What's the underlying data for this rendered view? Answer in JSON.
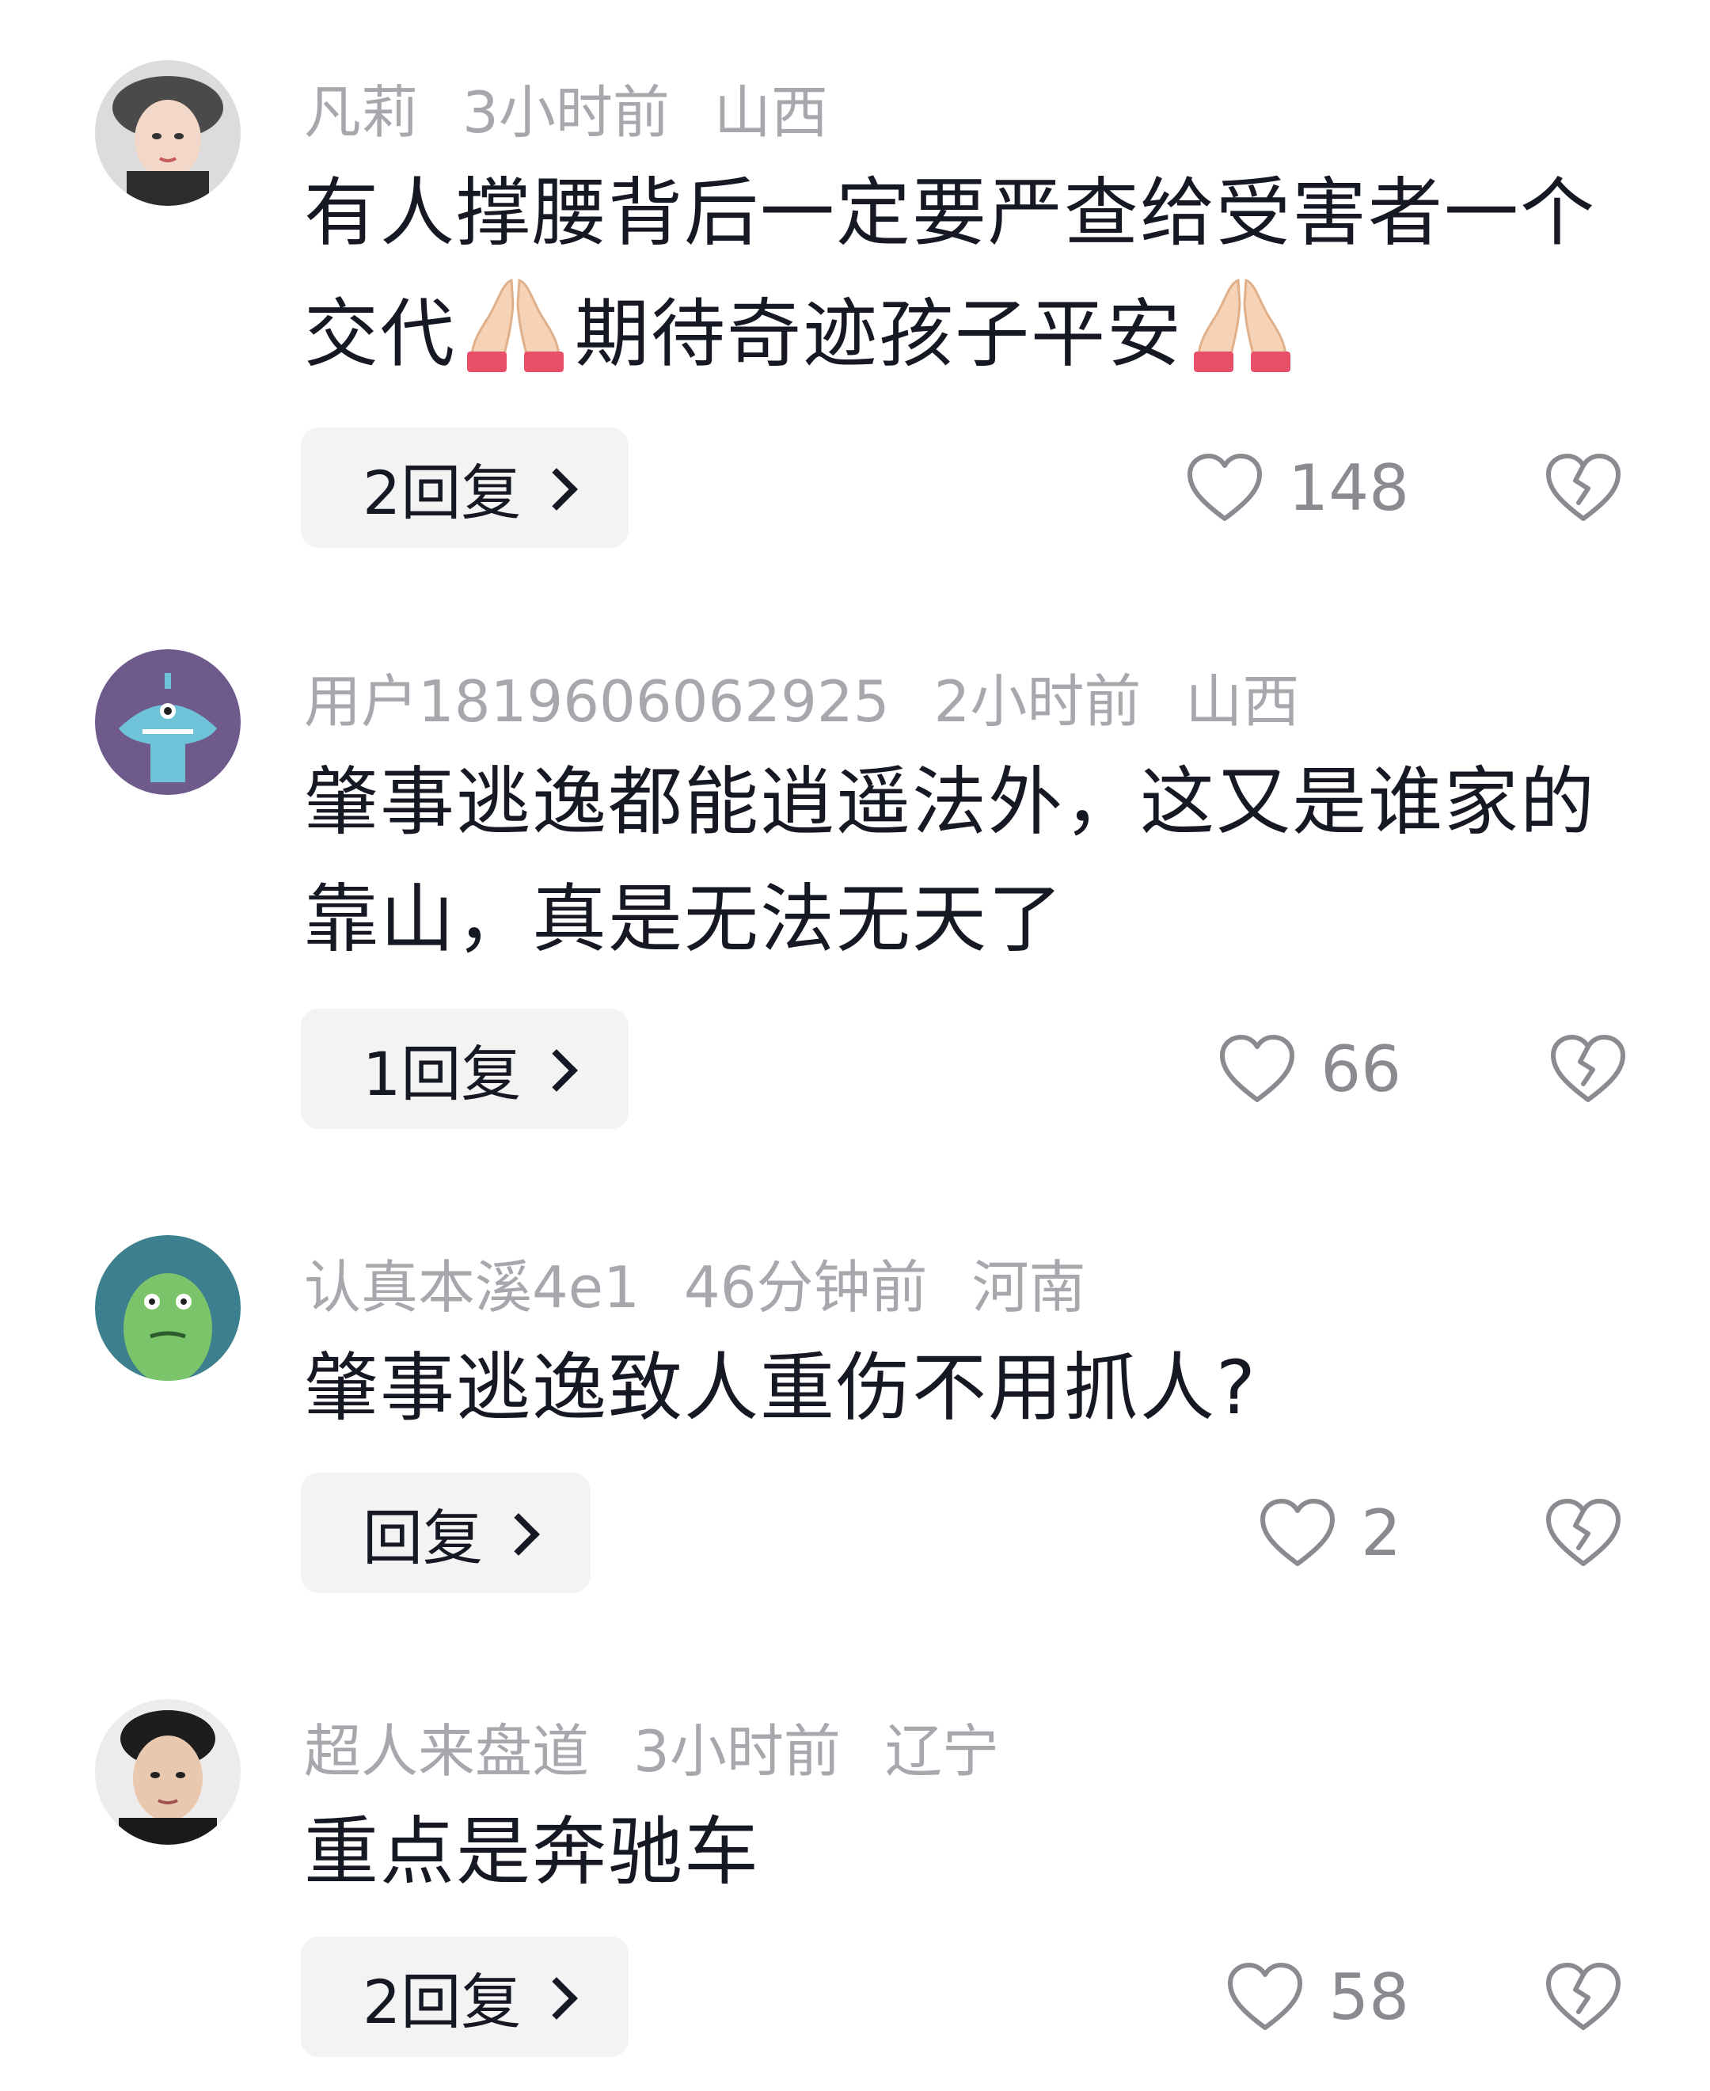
{
  "comments": [
    {
      "username": "凡莉",
      "time": "3小时前",
      "location": "山西",
      "text_part1": "有人撑腰背后一定要严查给受害者一个交代",
      "text_part2": "期待奇迹孩子平安",
      "reply_label": "2回复",
      "likes": "148"
    },
    {
      "username": "用户1819606062925",
      "time": "2小时前",
      "location": "山西",
      "text": "肇事逃逸都能逍遥法外，这又是谁家的靠山，真是无法无天了",
      "reply_label": "1回复",
      "likes": "66"
    },
    {
      "username": "认真本溪4e1",
      "time": "46分钟前",
      "location": "河南",
      "text": "肇事逃逸致人重伤不用抓人?",
      "reply_label": "回复",
      "likes": "2"
    },
    {
      "username": "超人来盘道",
      "time": "3小时前",
      "location": "辽宁",
      "text": "重点是奔驰车",
      "reply_label": "2回复",
      "likes": "58"
    }
  ],
  "icons": {
    "like": "heart-outline-icon",
    "dislike": "broken-heart-icon",
    "reply_chevron": "chevron-right-icon",
    "emoji": "folded-hands-emoji"
  }
}
